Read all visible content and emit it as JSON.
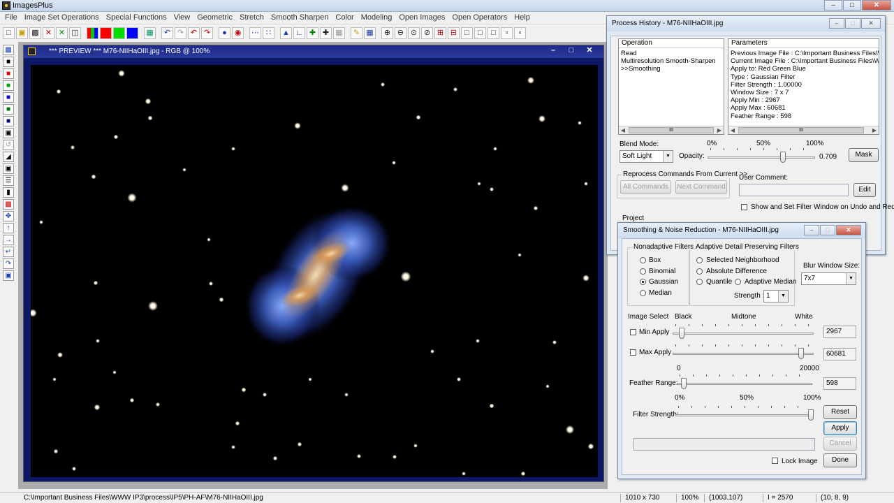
{
  "app": {
    "title": "ImagesPlus"
  },
  "menu": [
    "File",
    "Image Set Operations",
    "Special Functions",
    "View",
    "Geometric",
    "Stretch",
    "Smooth Sharpen",
    "Color",
    "Modeling",
    "Open Images",
    "Open Operators",
    "Help"
  ],
  "toolbar_icons": [
    "new-icon",
    "open-icon",
    "save-icon",
    "close-icon",
    "cancel-icon",
    "copy-icon",
    "rgb-channels-icon",
    "red-channel-icon",
    "green-channel-icon",
    "blue-channel-icon",
    "grid-icon",
    "undo-icon",
    "redo-icon",
    "undo-all-icon",
    "redo-all-icon",
    "record-icon",
    "record-stop-icon",
    "dots-icon",
    "align-icon",
    "histogram-icon",
    "levels-icon",
    "crosshair-icon",
    "select-icon",
    "pick-icon",
    "pencil-icon",
    "table-icon",
    "zoom-in-icon",
    "zoom-out-icon",
    "zoom-fit-icon",
    "zoom-actual-icon",
    "plus-box-icon",
    "minus-box-icon",
    "frame-1-icon",
    "frame-2-icon",
    "frame-3-icon",
    "frame-4-icon",
    "frame-5-icon"
  ],
  "left_tools": [
    "save-icon",
    "black-box-icon",
    "red-box-icon",
    "green-box-icon",
    "blue-box-icon",
    "mixed-box-icon",
    "mixed-box-2-icon",
    "square-icon",
    "hook-icon",
    "slash-icon",
    "select-box-icon",
    "bars-icon",
    "bar-icon",
    "region-icon",
    "move-icon",
    "arrow-up-icon",
    "arrow-right-icon",
    "rotate-left-icon",
    "rotate-right-icon",
    "frame-icon"
  ],
  "preview": {
    "title": "*** PREVIEW *** M76-NIIHaOIII.jpg - RGB @ 100%"
  },
  "colors": {
    "sky": "#000000",
    "frame": "#0c1a66",
    "nebula_blue": "#3f63c9",
    "nebula_orange": "#e6a050"
  },
  "status": {
    "path": "C:\\Important Business Files\\WWW IP3\\process\\IP5\\PH-AF\\M76-NIIHaOIII.jpg",
    "size": "1010 x 730",
    "zoom": "100%",
    "coords": "(1003,107)",
    "intensity": "I = 2570",
    "rgb": "(10, 8, 9)"
  },
  "history": {
    "title": "Process History - M76-NIIHaOIII.jpg",
    "operation_header": "Operation",
    "parameters_header": "Parameters",
    "operations": [
      "Read",
      "Multiresolution Smooth-Sharpen",
      ">>Smoothing"
    ],
    "parameters": [
      "Previous Image File : C:\\Important Business Files\\WW...",
      "Current Image File : C:\\Important Business Files\\WW...",
      "Apply to:  Red Green Blue",
      "Type : Gaussian Filter",
      "Filter Strength : 1.00000",
      "Window Size : 7 x 7",
      "Apply Min : 2967",
      "Apply Max : 60681",
      "Feather Range : 598"
    ],
    "blend_mode_label": "Blend Mode:",
    "blend_mode": "Soft Light",
    "opacity_label": "Opacity:",
    "opacity_value": "0.709",
    "opacity_fraction": 0.709,
    "scale": [
      "0%",
      "50%",
      "100%"
    ],
    "mask_button": "Mask",
    "reprocess_label": "Reprocess Commands From Current >>",
    "all_commands": "All Commands",
    "next_command": "Next Command",
    "user_comment_label": "User Comment:",
    "edit_button": "Edit",
    "show_filter_label": "Show and Set Filter Window on Undo and Redo",
    "project_label": "Project"
  },
  "smoothing": {
    "title": "Smoothing & Noise Reduction - M76-NIIHaOIII.jpg",
    "nonadaptive_label": "Nonadaptive Filters",
    "nonadaptive": [
      "Box",
      "Binomial",
      "Gaussian",
      "Median"
    ],
    "selected_filter": "Gaussian",
    "adaptive_label": "Adaptive Detail Preserving Filters",
    "adaptive": [
      "Selected Neighborhood",
      "Absolute Difference",
      "Quantile",
      "Adaptive Median"
    ],
    "strength_label": "Strength :",
    "strength": "1",
    "blur_window_label": "Blur Window Size:",
    "blur_window": "7x7",
    "image_select_label": "Image Select",
    "range_labels": [
      "Black",
      "Midtone",
      "White"
    ],
    "min_apply_label": "Min Apply",
    "min_apply_value": "2967",
    "min_apply_fraction": 0.045,
    "max_apply_label": "Max Apply",
    "max_apply_value": "60681",
    "max_apply_fraction": 0.926,
    "feather_scale": [
      "0",
      "20000"
    ],
    "feather_label": "Feather Range:",
    "feather_value": "598",
    "feather_fraction": 0.03,
    "strength_scale": [
      "0%",
      "50%",
      "100%"
    ],
    "filter_strength_label": "Filter Strength:",
    "filter_strength_fraction": 1.0,
    "reset_button": "Reset",
    "apply_button": "Apply",
    "cancel_button": "Cancel",
    "lock_image_label": "Lock Image",
    "done_button": "Done"
  }
}
